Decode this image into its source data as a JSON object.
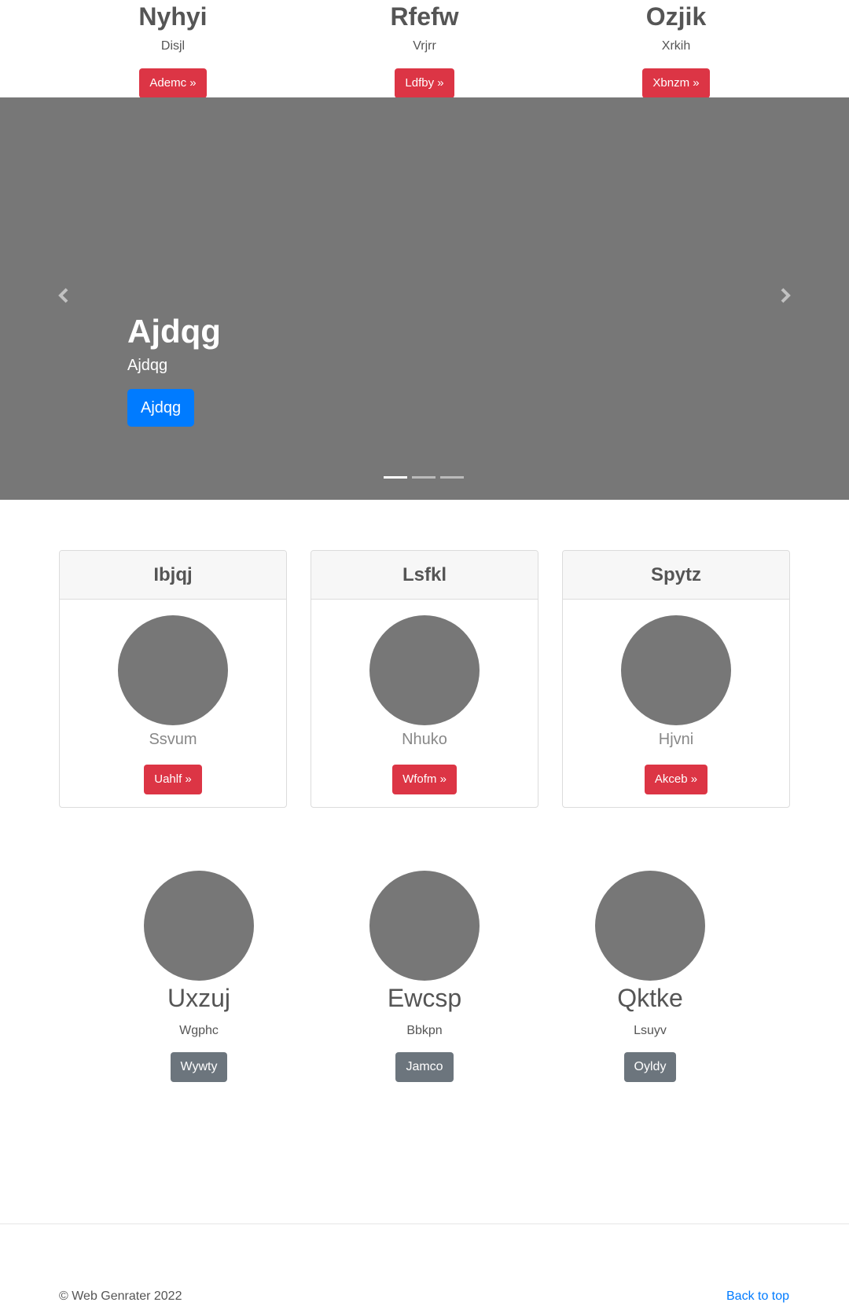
{
  "top_columns": [
    {
      "title": "Nyhyi",
      "subtitle": "Disjl",
      "button": "Ademc »"
    },
    {
      "title": "Rfefw",
      "subtitle": "Vrjrr",
      "button": "Ldfby »"
    },
    {
      "title": "Ozjik",
      "subtitle": "Xrkih",
      "button": "Xbnzm »"
    }
  ],
  "carousel": {
    "heading": "Ajdqg",
    "text": "Ajdqg",
    "button": "Ajdqg",
    "background": "#777777",
    "slide_count": 3,
    "active_slide": 1
  },
  "cards": [
    {
      "header": "Ibjqj",
      "name": "Ssvum",
      "button": "Uahlf »"
    },
    {
      "header": "Lsfkl",
      "name": "Nhuko",
      "button": "Wfofm »"
    },
    {
      "header": "Spytz",
      "name": "Hjvni",
      "button": "Akceb »"
    }
  ],
  "features": [
    {
      "name": "Uxzuj",
      "subtitle": "Wgphc",
      "button": "Wywty"
    },
    {
      "name": "Ewcsp",
      "subtitle": "Bbkpn",
      "button": "Jamco"
    },
    {
      "name": "Qktke",
      "subtitle": "Lsuyv",
      "button": "Oyldy"
    }
  ],
  "footer": {
    "copyright": "© Web Genrater 2022",
    "back_to_top": "Back to top"
  },
  "colors": {
    "red": "#dc3545",
    "blue": "#007bff",
    "gray_button": "#6c757d",
    "placeholder": "#777777"
  }
}
